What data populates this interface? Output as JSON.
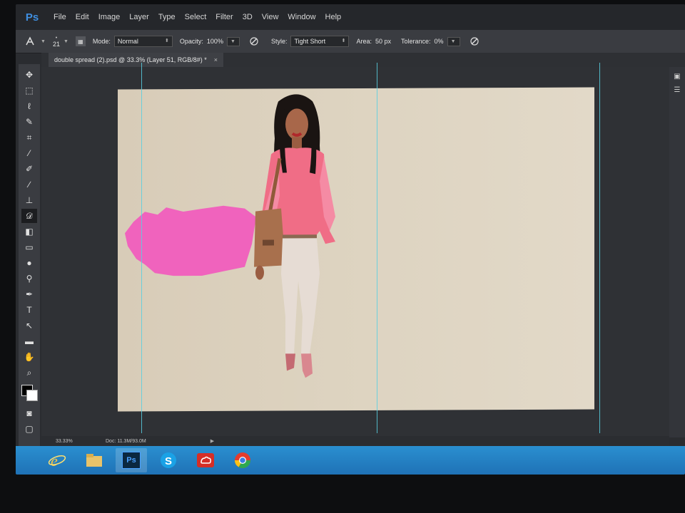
{
  "app": {
    "logo": "Ps",
    "brand_color": "#3f8fe0"
  },
  "menu": [
    "File",
    "Edit",
    "Image",
    "Layer",
    "Type",
    "Select",
    "Filter",
    "3D",
    "View",
    "Window",
    "Help"
  ],
  "options": {
    "brush_size": "21",
    "mode_label": "Mode:",
    "mode_value": "Normal",
    "opacity_label": "Opacity:",
    "opacity_value": "100%",
    "style_label": "Style:",
    "style_value": "Tight Short",
    "area_label": "Area:",
    "area_value": "50 px",
    "tolerance_label": "Tolerance:",
    "tolerance_value": "0%"
  },
  "document": {
    "tab_title": "double spread (2).psd @ 33.3% (Layer 51, RGB/8#) *",
    "close_glyph": "×"
  },
  "statusbar": {
    "zoom": "33.33%",
    "doc_size": "Doc: 11.3M/93.0M"
  },
  "tools": [
    "move-tool-icon",
    "marquee-tool-icon",
    "lasso-tool-icon",
    "quick-selection-tool-icon",
    "crop-tool-icon",
    "eyedropper-tool-icon",
    "healing-brush-tool-icon",
    "brush-tool-icon",
    "clone-stamp-tool-icon",
    "art-history-brush-tool-icon",
    "eraser-tool-icon",
    "gradient-tool-icon",
    "blur-tool-icon",
    "dodge-tool-icon",
    "pen-tool-icon",
    "type-tool-icon",
    "path-selection-tool-icon",
    "rectangle-tool-icon",
    "hand-tool-icon",
    "zoom-tool-icon"
  ],
  "colors": {
    "foreground": "#000000",
    "background": "#ffffff",
    "guide": "#58cfe0",
    "pink_stroke": "#f063bd"
  },
  "taskbar": [
    "internet-explorer-icon",
    "file-explorer-icon",
    "photoshop-icon",
    "skype-icon",
    "creative-cloud-icon",
    "chrome-icon"
  ],
  "taskbar_labels": {
    "photoshop": "Ps"
  }
}
